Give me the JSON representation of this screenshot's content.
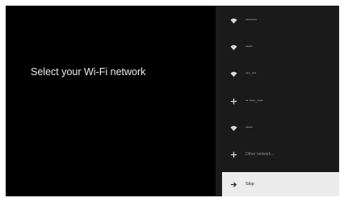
{
  "screen": {
    "title": "Select your Wi-Fi network"
  },
  "networks": [
    {
      "label": "••••••••",
      "icon": "wifi-icon",
      "selected": false
    },
    {
      "label": "•••••",
      "icon": "wifi-icon",
      "selected": false
    },
    {
      "label": "•••_•••",
      "icon": "wifi-icon",
      "selected": false
    },
    {
      "label": "•• ••••_••••",
      "icon": "add-icon",
      "selected": false
    },
    {
      "label": "•••••",
      "icon": "wifi-icon",
      "selected": false
    },
    {
      "label": "Other network...",
      "icon": "add-icon",
      "selected": false
    },
    {
      "label": "Skip",
      "icon": "arrow-right-icon",
      "selected": true
    }
  ],
  "colors": {
    "background": "#000000",
    "panel": "#1a1a1a",
    "selected_bg": "#ececec",
    "title_text": "#ececec",
    "item_text": "#8c8c8c"
  }
}
